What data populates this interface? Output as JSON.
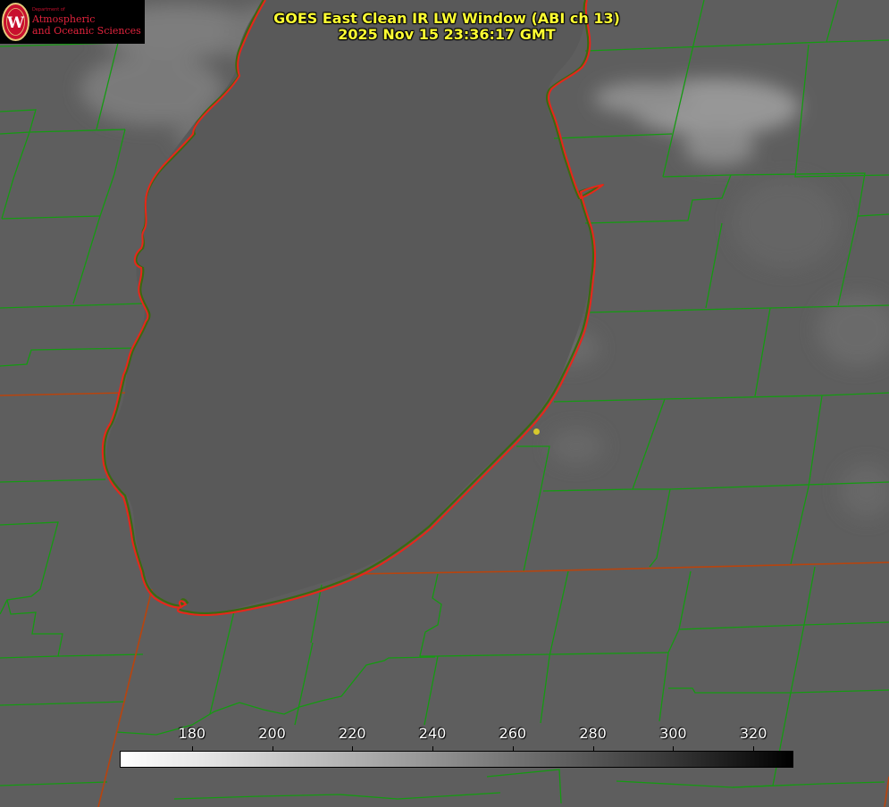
{
  "title": {
    "line1": "GOES East Clean IR LW Window (ABI ch 13)",
    "line2": "2025 Nov 15 23:36:17 GMT"
  },
  "logo": {
    "dept": "Department of",
    "line1": "Atmospheric",
    "line2": "and Oceanic Sciences",
    "seal_letter": "W"
  },
  "colorbar": {
    "ticks": [
      "180",
      "200",
      "220",
      "240",
      "260",
      "280",
      "300",
      "320"
    ],
    "range": [
      162,
      330
    ]
  },
  "colors": {
    "coastline": "#e8261a",
    "county_lines": "#159a12",
    "state_lines": "#b8440e",
    "title_text": "#ffff33",
    "station_marker": "#d6c92c",
    "background_gray": "#5f5f5f"
  },
  "image_type": "infrared satellite imagery (grayscale brightness temperature)"
}
